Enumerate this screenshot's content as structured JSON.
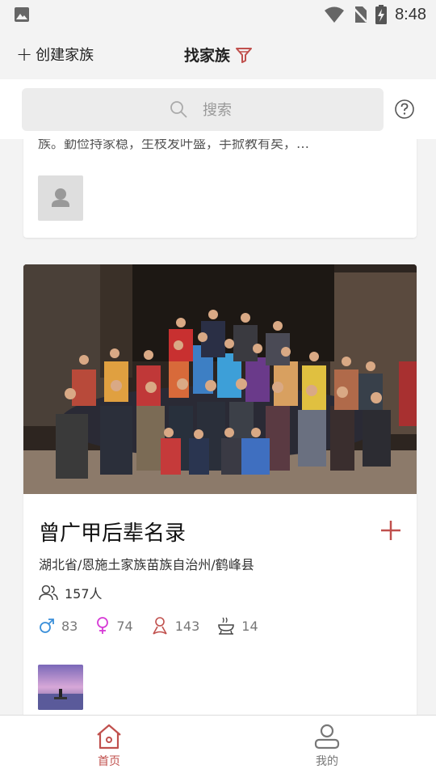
{
  "status_bar": {
    "time": "8:48"
  },
  "header": {
    "create_label": "创建家族",
    "title": "找家族"
  },
  "search": {
    "placeholder": "搜索"
  },
  "cards": [
    {
      "desc_partial": "族。勤俭持家稳，生枝发叶盛，手掀教有矣，…"
    },
    {
      "name": "曾广甲后辈名录",
      "location": "湖北省/恩施土家族苗族自治州/鹤峰县",
      "member_count": "157人",
      "male": "83",
      "female": "74",
      "deceased": "143",
      "generations": "14"
    }
  ],
  "tabs": [
    {
      "label": "首页",
      "active": true
    },
    {
      "label": "我的",
      "active": false
    }
  ],
  "colors": {
    "accent": "#c0504d",
    "male": "#3a8fd9",
    "female": "#d63ad6"
  }
}
